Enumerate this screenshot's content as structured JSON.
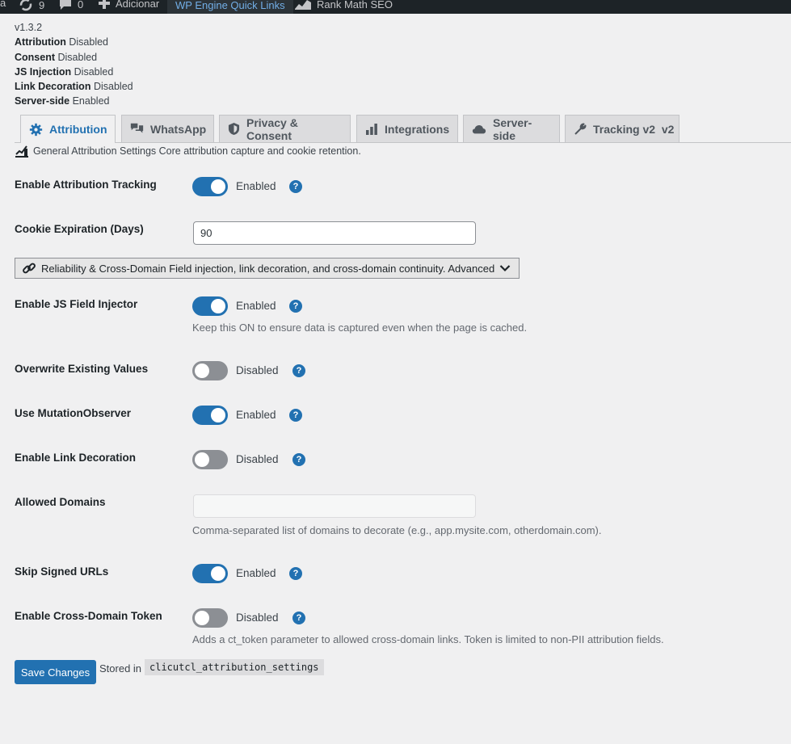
{
  "adminbar": {
    "fragment": "a",
    "updates_count": "9",
    "comments_count": "0",
    "new_label": "Adicionar",
    "quick_links_label": "WP Engine Quick Links",
    "rankmath_label": "Rank Math SEO"
  },
  "status": {
    "version": "v1.3.2",
    "items": [
      {
        "name": "Attribution",
        "value": "Disabled"
      },
      {
        "name": "Consent",
        "value": "Disabled"
      },
      {
        "name": "JS Injection",
        "value": "Disabled"
      },
      {
        "name": "Link Decoration",
        "value": "Disabled"
      },
      {
        "name": "Server-side",
        "value": "Enabled"
      }
    ]
  },
  "tabs": [
    {
      "label": "Attribution",
      "icon": "gear-icon",
      "active": true
    },
    {
      "label": "WhatsApp",
      "icon": "chat-bubbles-icon"
    },
    {
      "label": "Privacy & Consent",
      "icon": "shield-icon"
    },
    {
      "label": "Integrations",
      "icon": "bar-chart-icon"
    },
    {
      "label": "Server-side",
      "icon": "cloud-icon"
    },
    {
      "label": "Tracking v2  v2",
      "icon": "wrench-icon"
    }
  ],
  "section": {
    "description": "General Attribution Settings Core attribution capture and cookie retention."
  },
  "fields": {
    "attribution_tracking": {
      "label": "Enable Attribution Tracking",
      "state": "Enabled"
    },
    "cookie_expiration": {
      "label": "Cookie Expiration (Days)",
      "value": "90"
    },
    "accordion_label": "Reliability & Cross-Domain Field injection, link decoration, and cross-domain continuity. Advanced",
    "js_field_injector": {
      "label": "Enable JS Field Injector",
      "state": "Enabled",
      "hint": "Keep this ON to ensure data is captured even when the page is cached."
    },
    "overwrite_existing": {
      "label": "Overwrite Existing Values",
      "state": "Disabled"
    },
    "mutation_observer": {
      "label": "Use MutationObserver",
      "state": "Enabled"
    },
    "link_decoration": {
      "label": "Enable Link Decoration",
      "state": "Disabled"
    },
    "allowed_domains": {
      "label": "Allowed Domains",
      "value": "",
      "hint": "Comma-separated list of domains to decorate (e.g., app.mysite.com, otherdomain.com)."
    },
    "skip_signed_urls": {
      "label": "Skip Signed URLs",
      "state": "Enabled"
    },
    "cross_domain_token": {
      "label": "Enable Cross-Domain Token",
      "state": "Disabled",
      "hint": "Adds a ct_token parameter to allowed cross-domain links. Token is limited to non-PII attribution fields."
    }
  },
  "help_label": "?",
  "footer": {
    "save_label": "Save Changes",
    "stored_label": "Stored in",
    "option_name": "clicutcl_attribution_settings"
  },
  "colors": {
    "accent": "#2271b1",
    "adminbar": "#1d2327",
    "toggle_off": "#8c8f94"
  }
}
